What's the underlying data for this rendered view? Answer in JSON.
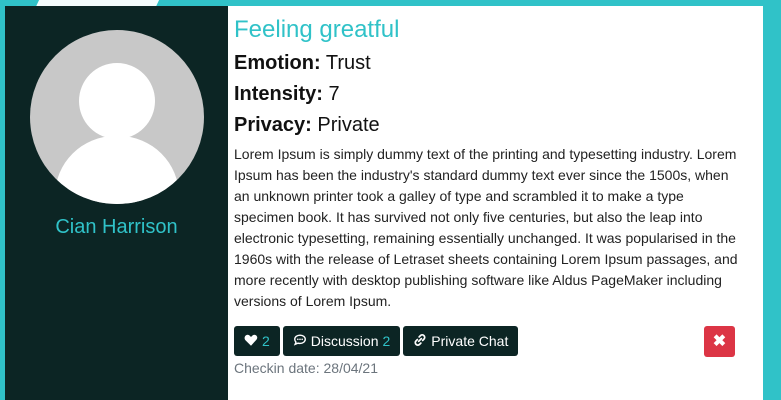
{
  "profile": {
    "name": "Cian Harrison"
  },
  "checkin": {
    "title": "Feeling greatful",
    "emotion": {
      "label": "Emotion:",
      "value": "Trust"
    },
    "intensity": {
      "label": "Intensity:",
      "value": "7"
    },
    "privacy": {
      "label": "Privacy:",
      "value": "Private"
    },
    "description": "Lorem Ipsum is simply dummy text of the printing and typesetting industry. Lorem Ipsum has been the industry's standard dummy text ever since the 1500s, when an unknown printer took a galley of type and scrambled it to make a type specimen book. It has survived not only five centuries, but also the leap into electronic typesetting, remaining essentially unchanged. It was popularised in the 1960s with the release of Letraset sheets containing Lorem Ipsum passages, and more recently with desktop publishing software like Aldus PageMaker including versions of Lorem Ipsum.",
    "date_text": "Checkin date: 28/04/21"
  },
  "actions": {
    "likes": "2",
    "discussion_label": "Discussion",
    "discussion_count": "2",
    "private_chat_label": "Private Chat",
    "delete_label": "✖"
  },
  "colors": {
    "accent": "#30c2c8",
    "sidebar": "#0c2524",
    "danger": "#dc3545"
  },
  "icons": {
    "like": "heart-icon",
    "discussion": "comment-icon",
    "private_chat": "link-icon",
    "delete": "close-icon",
    "avatar": "user-silhouette-icon"
  }
}
